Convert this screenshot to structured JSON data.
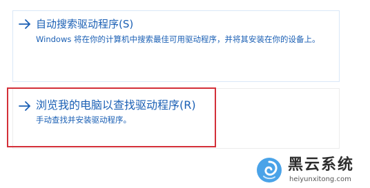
{
  "options": {
    "auto_search": {
      "title": "自动搜索驱动程序(S)",
      "description": "Windows 将在你的计算机中搜索最佳可用驱动程序，并将其安装在你的设备上。",
      "icon": "arrow-right-icon"
    },
    "browse": {
      "title": "浏览我的电脑以查找驱动程序(R)",
      "description": "手动查找并安装驱动程序。",
      "icon": "arrow-right-icon"
    }
  },
  "watermark": {
    "name": "黑云系统",
    "url": "heiyunxitong.com",
    "icon": "swirl-logo-icon"
  },
  "colors": {
    "link": "#1a5fb4",
    "highlight": "#d32f38",
    "logo_blue": "#4aa3e8"
  }
}
